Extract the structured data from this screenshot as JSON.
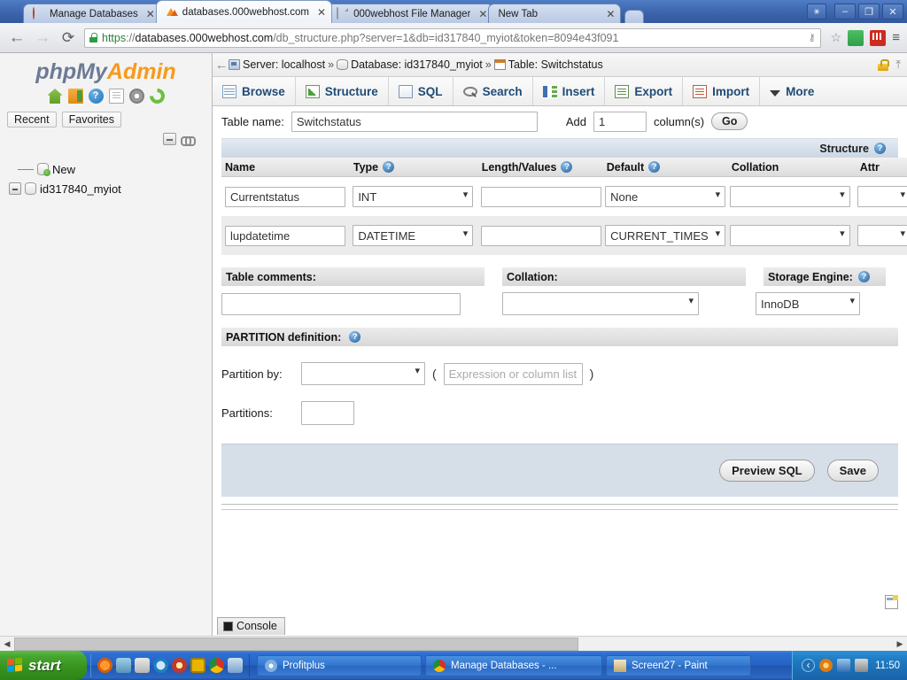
{
  "browser": {
    "tabs": [
      {
        "title": "Manage Databases",
        "favicon": "ring-icon",
        "active": false,
        "close_label": "✕"
      },
      {
        "title": "databases.000webhost.com",
        "favicon": "phpmyadmin-icon",
        "active": true,
        "close_label": "✕"
      },
      {
        "title": "000webhost File Manager",
        "favicon": "document-icon",
        "active": false,
        "close_label": "✕"
      },
      {
        "title": "New Tab",
        "favicon": "none",
        "active": false,
        "close_label": "✕"
      }
    ],
    "window_controls": {
      "user": "⚹",
      "minimize": "–",
      "maximize": "❐",
      "close": "✕"
    },
    "nav": {
      "back": "←",
      "forward": "→",
      "reload": "⟳"
    },
    "omnibox": {
      "scheme": "https",
      "separator": "://",
      "host": "databases.000webhost.com",
      "path": "/db_structure.php?server=1&db=id317840_myiot&token=8094e43f091",
      "full_url": "https://databases.000webhost.com/db_structure.php?server=1&db=id317840_myiot&token=8094e43f091",
      "key_glyph": "⚷",
      "star_glyph": "☆"
    },
    "extensions": [
      {
        "name": "adblock-extension-icon"
      },
      {
        "name": "red-extension-icon"
      }
    ],
    "menu_glyph": "≡"
  },
  "navpanel": {
    "logo": {
      "php": "php",
      "my": "My",
      "admin": "Admin"
    },
    "icons": [
      "home-icon",
      "exit-icon",
      "help-icon",
      "docs-icon",
      "settings-icon",
      "refresh-icon"
    ],
    "tabs": [
      {
        "label": "Recent"
      },
      {
        "label": "Favorites"
      }
    ],
    "collapse_icons": [
      "collapse-all-icon",
      "link-with-main-panel-icon"
    ],
    "tree": [
      {
        "label": "New",
        "icon": "new-database-icon",
        "expander": false
      },
      {
        "label": "id317840_myiot",
        "icon": "database-icon",
        "expander": true
      }
    ]
  },
  "breadcrumb": {
    "back_glyph": "←",
    "items": [
      {
        "icon": "server-icon",
        "label": "Server: localhost"
      },
      {
        "icon": "database-icon",
        "label": "Database: id317840_myiot"
      },
      {
        "icon": "table-icon",
        "label": "Table: Switchstatus"
      }
    ],
    "separator": "»",
    "right_icons": [
      "ssl-lock-icon",
      "collapse-navigation-icon"
    ]
  },
  "main_tabs": [
    {
      "label": "Browse",
      "icon": "browse-icon"
    },
    {
      "label": "Structure",
      "icon": "structure-icon"
    },
    {
      "label": "SQL",
      "icon": "sql-icon"
    },
    {
      "label": "Search",
      "icon": "search-icon"
    },
    {
      "label": "Insert",
      "icon": "insert-icon"
    },
    {
      "label": "Export",
      "icon": "export-icon"
    },
    {
      "label": "Import",
      "icon": "import-icon"
    },
    {
      "label": "More",
      "icon": "chevron-down-icon"
    }
  ],
  "table_form": {
    "table_name_label": "Table name:",
    "table_name_value": "Switchstatus",
    "add_label": "Add",
    "add_count_value": "1",
    "columns_label": "column(s)",
    "go_label": "Go",
    "structure_header": "Structure",
    "help_glyph": "?",
    "headers": [
      {
        "label": "Name",
        "help": false
      },
      {
        "label": "Type",
        "help": true
      },
      {
        "label": "Length/Values",
        "help": true
      },
      {
        "label": "Default",
        "help": true
      },
      {
        "label": "Collation",
        "help": false
      },
      {
        "label": "Attr",
        "help": false
      }
    ],
    "rows": [
      {
        "name": "Currentstatus",
        "type": "INT",
        "length": "",
        "default": "None",
        "collation": "",
        "attributes": ""
      },
      {
        "name": "lupdatetime",
        "type": "DATETIME",
        "length": "",
        "default": "CURRENT_TIMES",
        "collation": "",
        "attributes": ""
      }
    ],
    "table_comments_label": "Table comments:",
    "table_comments_value": "",
    "collation_label": "Collation:",
    "collation_value": "",
    "storage_engine_label": "Storage Engine:",
    "storage_engine_value": "InnoDB",
    "partition_definition_label": "PARTITION definition:",
    "partition_by_label": "Partition by:",
    "partition_by_value": "",
    "partition_expression_placeholder": "Expression or column list",
    "partition_expression_value": "",
    "paren_open": "(",
    "paren_close": ")",
    "partitions_label": "Partitions:",
    "partitions_value": "",
    "preview_sql_label": "Preview SQL",
    "save_label": "Save"
  },
  "console": {
    "label": "Console",
    "icon": "console-icon"
  },
  "taskbar": {
    "start_label": "start",
    "quick_launch": [
      "media-player-icon",
      "folder-icon",
      "calculator-icon",
      "internet-explorer-icon",
      "opera-icon",
      "clock-app-icon",
      "chrome-icon",
      "paint-icon"
    ],
    "tasks": [
      {
        "label": "Profitplus",
        "icon": "profitplus-icon"
      },
      {
        "label": "Manage Databases - ...",
        "icon": "chrome-icon"
      },
      {
        "label": "Screen27 - Paint",
        "icon": "paint-icon"
      }
    ],
    "tray": {
      "expand_glyph": "‹",
      "icons": [
        "update-icon",
        "network-icon",
        "volume-icon"
      ],
      "clock": "11:50"
    }
  },
  "colors": {
    "accent_blue": "#1f4b75",
    "taskbar_blue": "#2464c4",
    "start_green": "#38941f",
    "pma_orange": "#f89a1c",
    "panel_header": "#ccd7e5",
    "footer_panel": "#d6dfe8"
  }
}
